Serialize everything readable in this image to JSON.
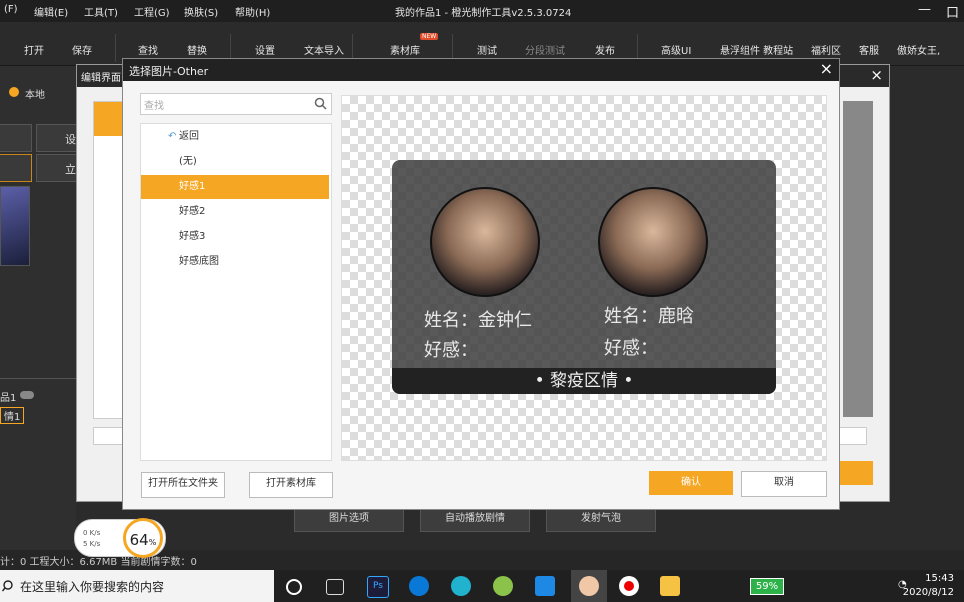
{
  "menu": {
    "items": [
      "(F)",
      "编辑(E)",
      "工具(T)",
      "工程(G)",
      "换肤(S)",
      "帮助(H)"
    ],
    "app_title": "我的作品1 - 橙光制作工具v2.5.3.0724",
    "minimize": "—",
    "maximize": "口"
  },
  "toolbar": {
    "open": "打开",
    "save": "保存",
    "find": "查找",
    "replace": "替换",
    "settings": "设置",
    "text_import": "文本导入",
    "asset_library": "素材库",
    "new_badge": "NEW",
    "test": "测试",
    "segment_test": "分段测试",
    "publish": "发布",
    "advanced_ui": "高级UI",
    "float_widget": "悬浮组件 教程站",
    "welfare": "福利区",
    "service": "客服",
    "user": "傲娇女王,"
  },
  "left_panel": {
    "local_label": "本地",
    "cells": [
      "",
      "",
      "设",
      "立"
    ],
    "project_label": "品1",
    "scene_label": "情1"
  },
  "back_dialog": {
    "title": "编辑界面"
  },
  "dialog": {
    "title": "选择图片-Other",
    "close": "×",
    "search_placeholder": "查找",
    "items": [
      {
        "label": "返回"
      },
      {
        "label": "(无)"
      },
      {
        "label": "好感1"
      },
      {
        "label": "好感2"
      },
      {
        "label": "好感3"
      },
      {
        "label": "好感底图"
      }
    ],
    "selected_index": 2,
    "open_folder": "打开所在文件夹",
    "open_library": "打开素材库",
    "ok": "确认",
    "cancel": "取消"
  },
  "preview_card": {
    "name1": "姓名：金钟仁",
    "favor1": "好感：",
    "name2": "姓名：鹿晗",
    "favor2": "好感：",
    "footer": "• 黎疫区情 •"
  },
  "bottom_buttons": {
    "image_options": "图片选项",
    "auto_play": "自动播放剧情",
    "bubble": "发射气泡"
  },
  "status_bar": {
    "text": "计：0 工程大小：6.67MB 当前剧情字数：0"
  },
  "net_widget": {
    "up": "0 K/s",
    "down": "5 K/s",
    "percent": "64",
    "percent_unit": "%"
  },
  "taskbar": {
    "search_text": "在这里输入你要搜索的内容",
    "battery": "59%",
    "time": "15:43",
    "date": "2020/8/12"
  },
  "colors": {
    "accent": "#f5a623",
    "dialog_title_bg": "#222222"
  }
}
